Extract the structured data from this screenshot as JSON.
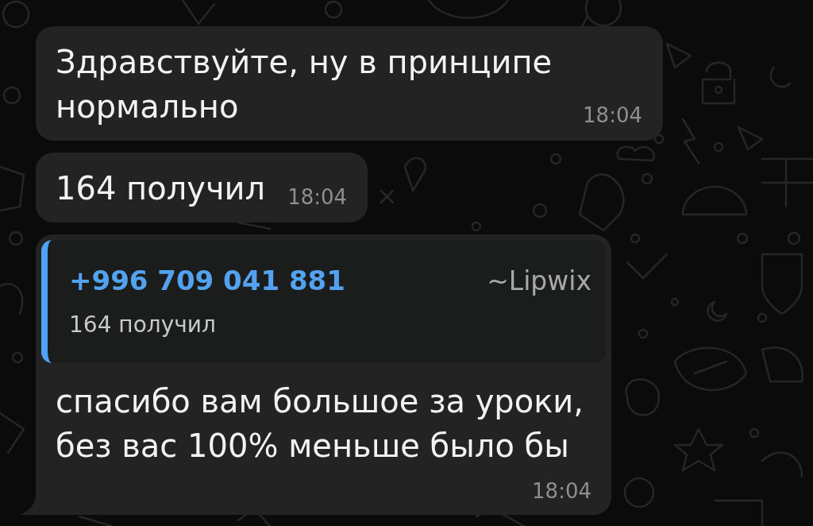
{
  "messages": [
    {
      "text": "Здравствуйте, ну в принципе нормально",
      "time": "18:04"
    },
    {
      "text": "164 получил",
      "time": "18:04"
    },
    {
      "quote": {
        "sender": "+996 709 041 881",
        "name": "~Lipwix",
        "text": "164 получил"
      },
      "text": "спасибо вам большое за уроки, без вас 100% меньше было бы",
      "time": "18:04"
    }
  ]
}
